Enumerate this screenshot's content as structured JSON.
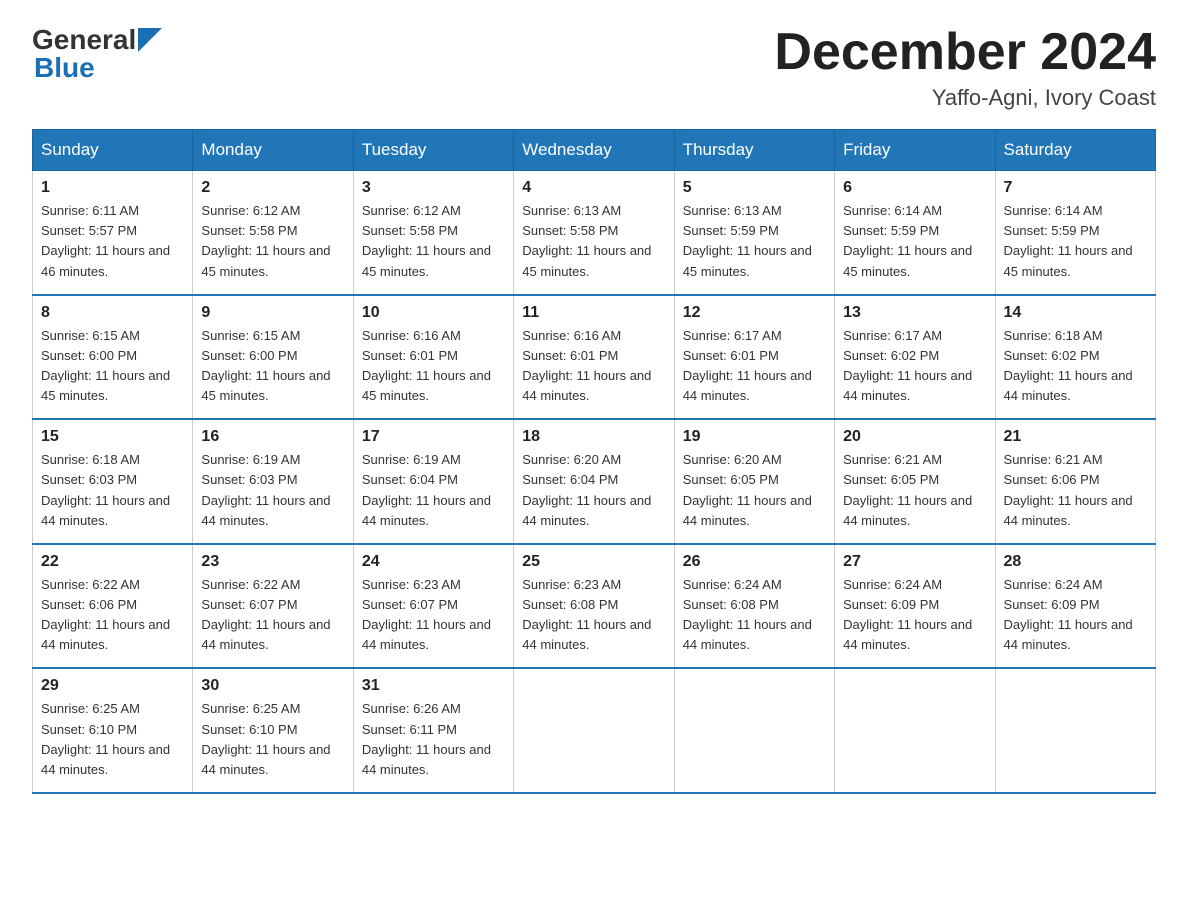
{
  "header": {
    "logo_general": "General",
    "logo_blue": "Blue",
    "month_title": "December 2024",
    "location": "Yaffo-Agni, Ivory Coast"
  },
  "days_of_week": [
    "Sunday",
    "Monday",
    "Tuesday",
    "Wednesday",
    "Thursday",
    "Friday",
    "Saturday"
  ],
  "weeks": [
    [
      {
        "day": "1",
        "sunrise": "6:11 AM",
        "sunset": "5:57 PM",
        "daylight": "11 hours and 46 minutes."
      },
      {
        "day": "2",
        "sunrise": "6:12 AM",
        "sunset": "5:58 PM",
        "daylight": "11 hours and 45 minutes."
      },
      {
        "day": "3",
        "sunrise": "6:12 AM",
        "sunset": "5:58 PM",
        "daylight": "11 hours and 45 minutes."
      },
      {
        "day": "4",
        "sunrise": "6:13 AM",
        "sunset": "5:58 PM",
        "daylight": "11 hours and 45 minutes."
      },
      {
        "day": "5",
        "sunrise": "6:13 AM",
        "sunset": "5:59 PM",
        "daylight": "11 hours and 45 minutes."
      },
      {
        "day": "6",
        "sunrise": "6:14 AM",
        "sunset": "5:59 PM",
        "daylight": "11 hours and 45 minutes."
      },
      {
        "day": "7",
        "sunrise": "6:14 AM",
        "sunset": "5:59 PM",
        "daylight": "11 hours and 45 minutes."
      }
    ],
    [
      {
        "day": "8",
        "sunrise": "6:15 AM",
        "sunset": "6:00 PM",
        "daylight": "11 hours and 45 minutes."
      },
      {
        "day": "9",
        "sunrise": "6:15 AM",
        "sunset": "6:00 PM",
        "daylight": "11 hours and 45 minutes."
      },
      {
        "day": "10",
        "sunrise": "6:16 AM",
        "sunset": "6:01 PM",
        "daylight": "11 hours and 45 minutes."
      },
      {
        "day": "11",
        "sunrise": "6:16 AM",
        "sunset": "6:01 PM",
        "daylight": "11 hours and 44 minutes."
      },
      {
        "day": "12",
        "sunrise": "6:17 AM",
        "sunset": "6:01 PM",
        "daylight": "11 hours and 44 minutes."
      },
      {
        "day": "13",
        "sunrise": "6:17 AM",
        "sunset": "6:02 PM",
        "daylight": "11 hours and 44 minutes."
      },
      {
        "day": "14",
        "sunrise": "6:18 AM",
        "sunset": "6:02 PM",
        "daylight": "11 hours and 44 minutes."
      }
    ],
    [
      {
        "day": "15",
        "sunrise": "6:18 AM",
        "sunset": "6:03 PM",
        "daylight": "11 hours and 44 minutes."
      },
      {
        "day": "16",
        "sunrise": "6:19 AM",
        "sunset": "6:03 PM",
        "daylight": "11 hours and 44 minutes."
      },
      {
        "day": "17",
        "sunrise": "6:19 AM",
        "sunset": "6:04 PM",
        "daylight": "11 hours and 44 minutes."
      },
      {
        "day": "18",
        "sunrise": "6:20 AM",
        "sunset": "6:04 PM",
        "daylight": "11 hours and 44 minutes."
      },
      {
        "day": "19",
        "sunrise": "6:20 AM",
        "sunset": "6:05 PM",
        "daylight": "11 hours and 44 minutes."
      },
      {
        "day": "20",
        "sunrise": "6:21 AM",
        "sunset": "6:05 PM",
        "daylight": "11 hours and 44 minutes."
      },
      {
        "day": "21",
        "sunrise": "6:21 AM",
        "sunset": "6:06 PM",
        "daylight": "11 hours and 44 minutes."
      }
    ],
    [
      {
        "day": "22",
        "sunrise": "6:22 AM",
        "sunset": "6:06 PM",
        "daylight": "11 hours and 44 minutes."
      },
      {
        "day": "23",
        "sunrise": "6:22 AM",
        "sunset": "6:07 PM",
        "daylight": "11 hours and 44 minutes."
      },
      {
        "day": "24",
        "sunrise": "6:23 AM",
        "sunset": "6:07 PM",
        "daylight": "11 hours and 44 minutes."
      },
      {
        "day": "25",
        "sunrise": "6:23 AM",
        "sunset": "6:08 PM",
        "daylight": "11 hours and 44 minutes."
      },
      {
        "day": "26",
        "sunrise": "6:24 AM",
        "sunset": "6:08 PM",
        "daylight": "11 hours and 44 minutes."
      },
      {
        "day": "27",
        "sunrise": "6:24 AM",
        "sunset": "6:09 PM",
        "daylight": "11 hours and 44 minutes."
      },
      {
        "day": "28",
        "sunrise": "6:24 AM",
        "sunset": "6:09 PM",
        "daylight": "11 hours and 44 minutes."
      }
    ],
    [
      {
        "day": "29",
        "sunrise": "6:25 AM",
        "sunset": "6:10 PM",
        "daylight": "11 hours and 44 minutes."
      },
      {
        "day": "30",
        "sunrise": "6:25 AM",
        "sunset": "6:10 PM",
        "daylight": "11 hours and 44 minutes."
      },
      {
        "day": "31",
        "sunrise": "6:26 AM",
        "sunset": "6:11 PM",
        "daylight": "11 hours and 44 minutes."
      },
      null,
      null,
      null,
      null
    ]
  ]
}
